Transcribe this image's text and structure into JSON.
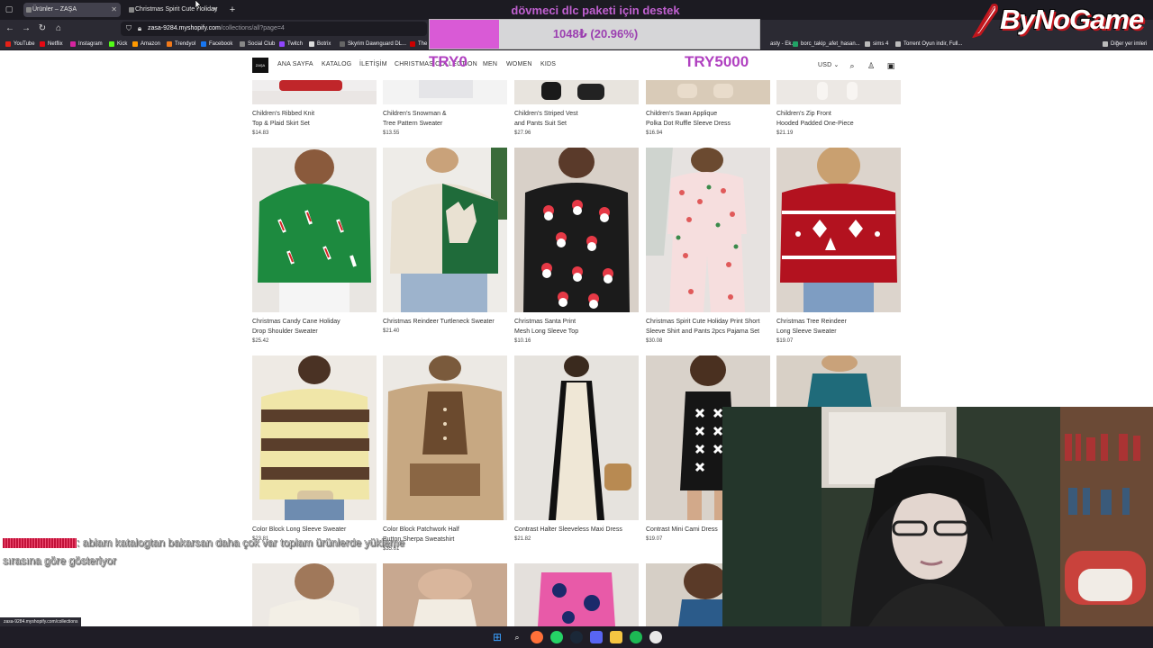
{
  "browser": {
    "tabs": [
      {
        "title": "Ürünler – ZAŞA",
        "active": true
      },
      {
        "title": "Christmas Spirit Cute Holiday",
        "active": false
      }
    ],
    "url_host": "zasa-9284.myshopify.com",
    "url_path": "/collections/all?page=4",
    "bookmarks": [
      "YouTube",
      "Netflix",
      "Instagram",
      "Kick",
      "Amazon",
      "Trendyol",
      "Facebook",
      "Social Club",
      "Twitch",
      "Botrix",
      "Skyrim Dawnguard DL...",
      "The E",
      "asty - Ek...",
      "borc_takip_afet_hasan...",
      "sims 4",
      "Torrent Oyun indir, Full...",
      "Diğer yer imleri"
    ],
    "status_url": "zasa-9284.myshopify.com/collections"
  },
  "store": {
    "logo": "ZAŞA",
    "nav": [
      "ANA SAYFA",
      "KATALOG",
      "İLETİŞİM",
      "CHRISTMAS COLLECTION",
      "MEN",
      "WOMEN",
      "KIDS"
    ],
    "currency": "USD"
  },
  "products": [
    {
      "name_lines": [
        "Children's Ribbed Knit",
        "Top & Plaid Skirt Set"
      ],
      "price": "$14.83"
    },
    {
      "name_lines": [
        "Children's Snowman &",
        "Tree Pattern Sweater"
      ],
      "price": "$13.55"
    },
    {
      "name_lines": [
        "Children's Striped Vest",
        "and Pants Suit Set"
      ],
      "price": "$27.96"
    },
    {
      "name_lines": [
        "Children's Swan Applique",
        "Polka Dot Ruffle Sleeve Dress"
      ],
      "price": "$16.94"
    },
    {
      "name_lines": [
        "Children's Zip Front",
        "Hooded Padded One-Piece"
      ],
      "price": "$21.19"
    },
    {
      "name_lines": [
        "Christmas Candy Cane Holiday",
        "Drop Shoulder Sweater"
      ],
      "price": "$25.42"
    },
    {
      "name_lines": [
        "Christmas Reindeer Turtleneck Sweater",
        ""
      ],
      "price": "$21.40"
    },
    {
      "name_lines": [
        "Christmas Santa Print",
        "Mesh Long Sleeve Top"
      ],
      "price": "$10.16"
    },
    {
      "name_lines": [
        "Christmas Spirit Cute Holiday Print Short",
        "Sleeve Shirt and Pants 2pcs Pajama Set"
      ],
      "price": "$30.08"
    },
    {
      "name_lines": [
        "Christmas Tree Reindeer",
        "Long Sleeve Sweater"
      ],
      "price": "$19.07"
    },
    {
      "name_lines": [
        "Color Block Long Sleeve Sweater",
        ""
      ],
      "price": "$23.81"
    },
    {
      "name_lines": [
        "Color Block Patchwork Half",
        "Button Sherpa Sweatshirt"
      ],
      "price": "$35.61"
    },
    {
      "name_lines": [
        "Contrast Halter Sleeveless Maxi Dress",
        ""
      ],
      "price": "$21.82"
    },
    {
      "name_lines": [
        "Contrast Mini Cami Dress",
        ""
      ],
      "price": "$19.07"
    }
  ],
  "overlay": {
    "donation_title": "dövmeci dlc paketi için destek",
    "donation_amount": "1048₺ (20.96%)",
    "donation_progress_pct": 20.96,
    "goal_start": "TRY0",
    "goal_end": "TRY5000",
    "brand": "ByNoGame",
    "chat_message_line1": ": ablam katalogtan bakarsan daha çok var toplam ürünlerde yükleme",
    "chat_message_line2": "sırasına göre gösteriyor"
  },
  "colors": {
    "accent_purple": "#b040c0",
    "donation_fill": "#d95ad6",
    "brand_red": "#c0161d"
  }
}
